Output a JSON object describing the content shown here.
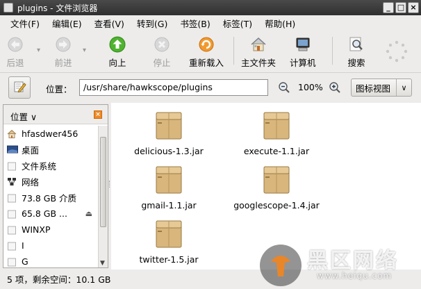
{
  "window": {
    "title": "plugins - 文件浏览器"
  },
  "menu": [
    "文件(F)",
    "编辑(E)",
    "查看(V)",
    "转到(G)",
    "书签(B)",
    "标签(T)",
    "帮助(H)"
  ],
  "toolbar": {
    "back": "后退",
    "forward": "前进",
    "up": "向上",
    "stop": "停止",
    "reload": "重新载入",
    "home": "主文件夹",
    "computer": "计算机",
    "search": "搜索"
  },
  "location": {
    "label": "位置：",
    "path": "/usr/share/hawkscope/plugins",
    "zoom": "100%",
    "view_mode": "图标视图"
  },
  "sidebar": {
    "title": "位置",
    "items": [
      {
        "label": "hfasdwer456",
        "icon": "home-folder-icon"
      },
      {
        "label": "桌面",
        "icon": "desktop-icon"
      },
      {
        "label": "文件系统",
        "icon": "drive-icon"
      },
      {
        "label": "网络",
        "icon": "network-icon"
      },
      {
        "label": "73.8 GB 介质",
        "icon": "drive-icon"
      },
      {
        "label": "65.8 GB ...",
        "icon": "drive-icon",
        "eject": true
      },
      {
        "label": "WINXP",
        "icon": "drive-icon"
      },
      {
        "label": "I",
        "icon": "drive-icon"
      },
      {
        "label": "G",
        "icon": "drive-icon"
      }
    ]
  },
  "files": [
    {
      "name": "delicious-1.3.jar"
    },
    {
      "name": "execute-1.1.jar"
    },
    {
      "name": "gmail-1.1.jar"
    },
    {
      "name": "googlescope-1.4.jar"
    },
    {
      "name": "twitter-1.5.jar"
    }
  ],
  "status": "5 项，剩余空间：10.1 GB",
  "watermark": {
    "text": "黑区网络",
    "url": "www.heiqu.com"
  }
}
